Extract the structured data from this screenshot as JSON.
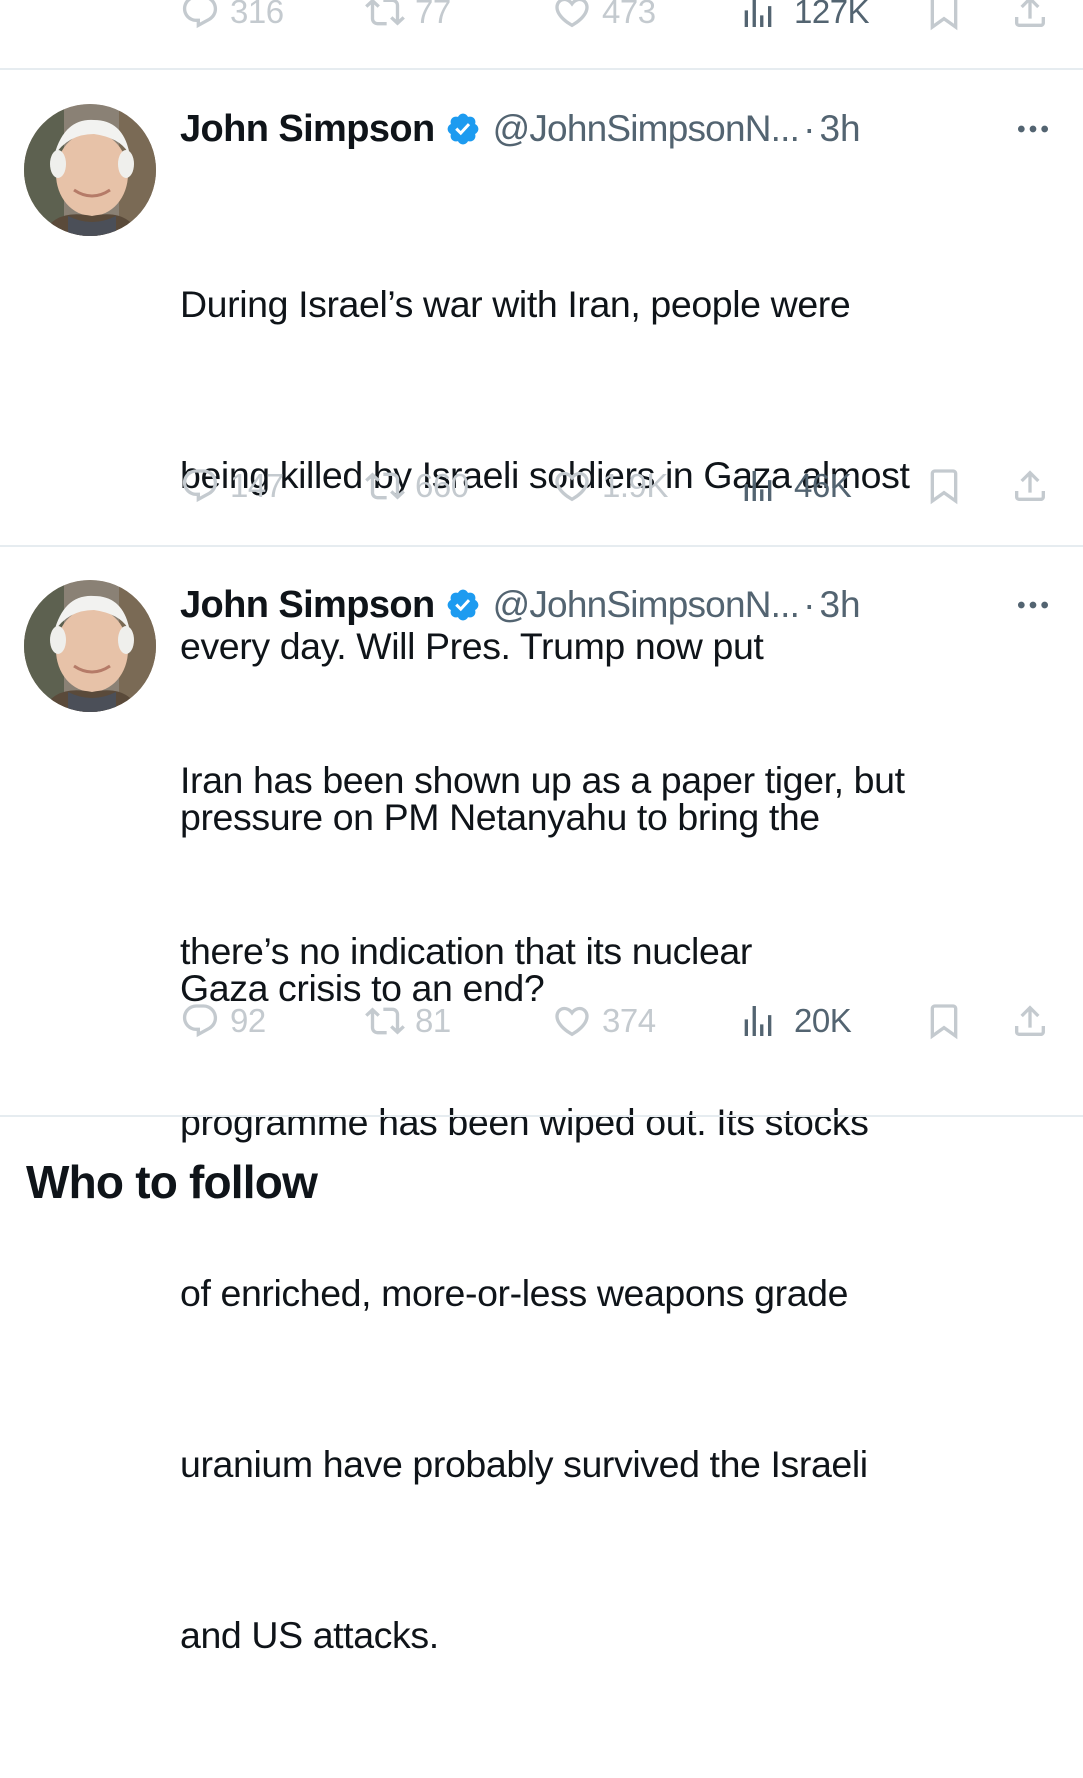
{
  "top_stats": {
    "replies": "316",
    "reposts": "77",
    "likes": "473",
    "views": "127K"
  },
  "tweets": [
    {
      "author_name": "John Simpson",
      "handle": "@JohnSimpsonN...",
      "separator": "·",
      "time": "3h",
      "text_lines": [
        "During Israel’s war with Iran, people were",
        "being killed by Israeli soldiers in Gaza almost",
        "every day.  Will Pres. Trump now put",
        "pressure on PM Netanyahu to bring the",
        "Gaza crisis to an end?"
      ],
      "replies": "147",
      "reposts": "660",
      "likes": "1.9K",
      "views": "46K"
    },
    {
      "author_name": "John Simpson",
      "handle": "@JohnSimpsonN...",
      "separator": "·",
      "time": "3h",
      "text_lines": [
        "Iran has been shown up as a paper tiger, but",
        "there’s no indication that its nuclear",
        "programme has been wiped out.  Its stocks",
        "of enriched, more-or-less weapons grade",
        "uranium have probably survived the Israeli",
        "and US attacks."
      ],
      "replies": "92",
      "reposts": "81",
      "likes": "374",
      "views": "20K"
    }
  ],
  "section_title": "Who to follow",
  "icons": {
    "reply": "reply-icon",
    "repost": "repost-icon",
    "like": "heart-icon",
    "views": "views-chart-icon",
    "bookmark": "bookmark-icon",
    "share": "share-icon",
    "verified": "verified-badge-icon",
    "more": "more-icon"
  },
  "colors": {
    "verified_blue": "#1d9bf0",
    "secondary_text": "#536471",
    "faded_action": "#c4cacf",
    "divider": "#e6ecf0"
  }
}
